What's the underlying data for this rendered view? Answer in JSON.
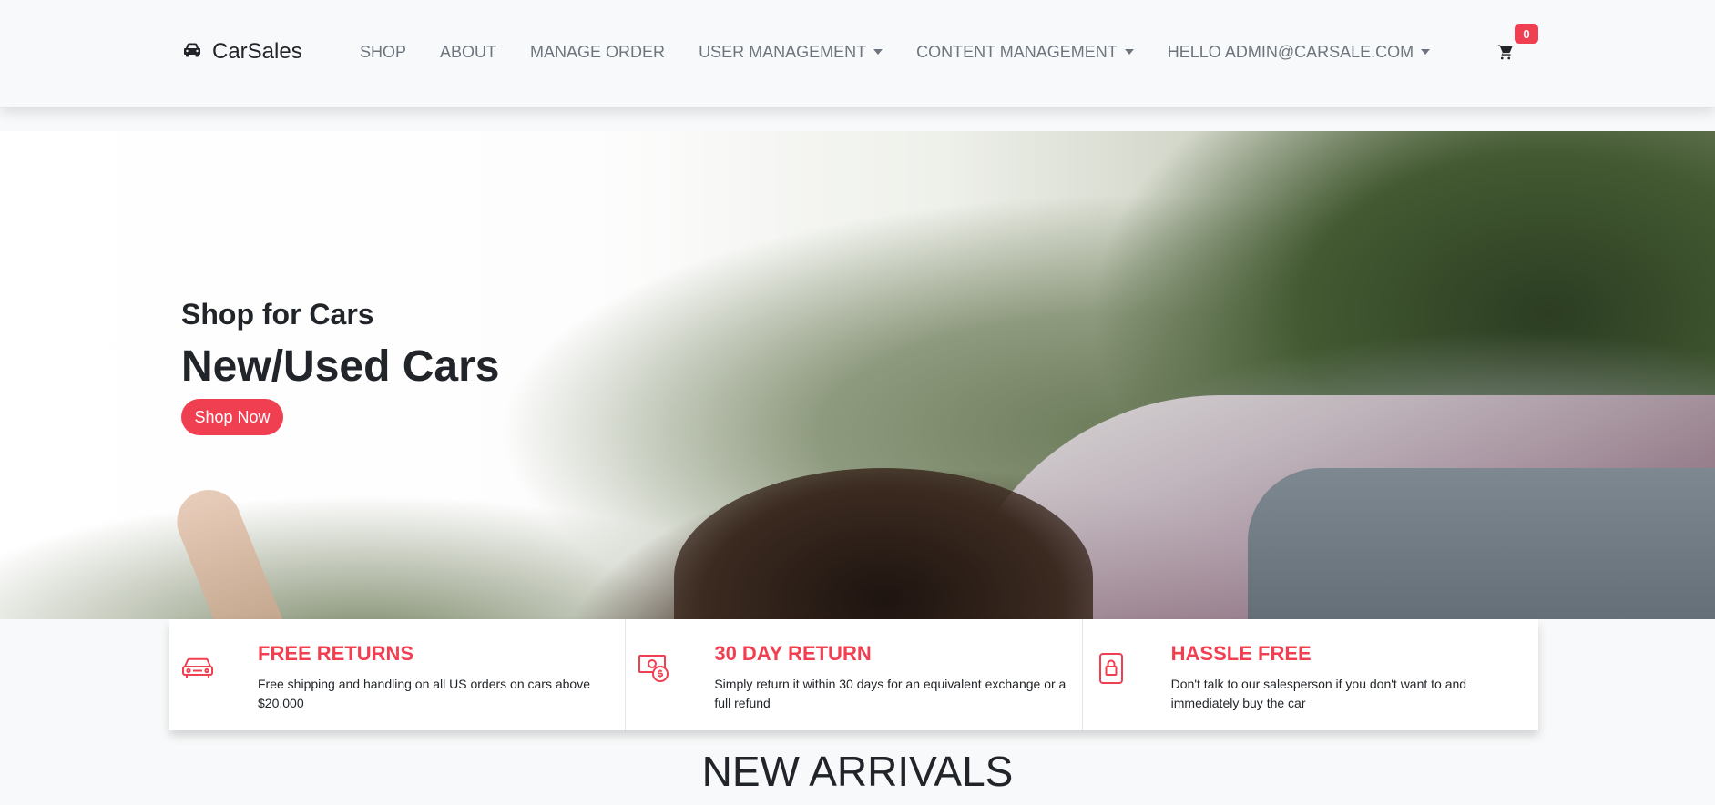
{
  "brand": {
    "name": "CarSales",
    "icon": "car-icon"
  },
  "nav": {
    "items": [
      {
        "label": "SHOP",
        "dropdown": false
      },
      {
        "label": "ABOUT",
        "dropdown": false
      },
      {
        "label": "MANAGE ORDER",
        "dropdown": false
      },
      {
        "label": "USER MANAGEMENT",
        "dropdown": true
      },
      {
        "label": "CONTENT MANAGEMENT",
        "dropdown": true
      },
      {
        "label": "HELLO ADMIN@CARSALE.COM",
        "dropdown": true
      }
    ],
    "cart_icon": "cart-icon",
    "cart_count": "0"
  },
  "hero": {
    "subtitle": "Shop for Cars",
    "title": "New/Used Cars",
    "cta": "Shop Now"
  },
  "features": [
    {
      "icon": "car-icon",
      "title": "FREE RETURNS",
      "description": "Free shipping and handling on all US orders on cars above $20,000"
    },
    {
      "icon": "money-icon",
      "title": "30 DAY RETURN",
      "description": "Simply return it within 30 days for an equivalent exchange or a full refund"
    },
    {
      "icon": "lock-icon",
      "title": "HASSLE FREE",
      "description": "Don't talk to our salesperson if you don't want to and immediately buy the car"
    }
  ],
  "section_title": "NEW ARRIVALS",
  "colors": {
    "accent": "#f13f52",
    "nav_text": "#6c757d",
    "background": "#f8f9fa"
  }
}
